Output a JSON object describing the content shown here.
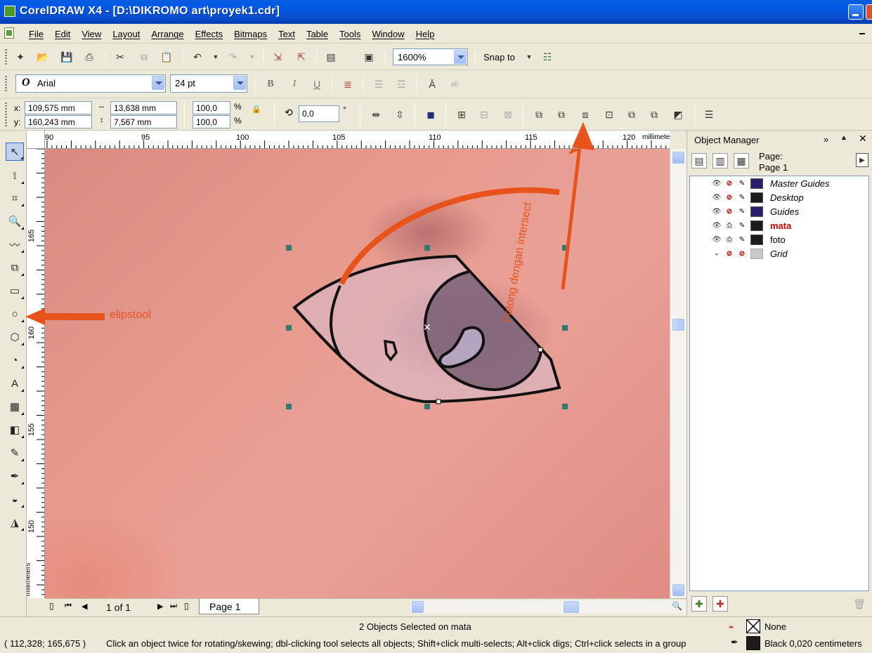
{
  "window": {
    "title": "CorelDRAW X4 - [D:\\DIKROMO art\\proyek1.cdr]"
  },
  "menu": [
    "File",
    "Edit",
    "View",
    "Layout",
    "Arrange",
    "Effects",
    "Bitmaps",
    "Text",
    "Table",
    "Tools",
    "Window",
    "Help"
  ],
  "standard_toolbar": {
    "zoom_level": "1600%",
    "snap_label": "Snap to"
  },
  "text_toolbar": {
    "font_name": "Arial",
    "font_size": "24 pt",
    "bold": "B",
    "italic": "I",
    "underline": "U"
  },
  "property_bar": {
    "x_label": "x:",
    "x_value": "109,575 mm",
    "y_label": "y:",
    "y_value": "160,243 mm",
    "width_value": "13,638 mm",
    "height_value": "7,567 mm",
    "scale_x": "100,0",
    "scale_y": "100,0",
    "percent": "%",
    "rotation": "0,0",
    "degree": "°"
  },
  "rulers": {
    "h_ticks": [
      "90",
      "95",
      "100",
      "105",
      "110",
      "115",
      "120"
    ],
    "h_unit": "millimeters",
    "v_ticks": [
      "165",
      "160",
      "155",
      "150"
    ],
    "v_unit": "millimeters"
  },
  "annotations": {
    "ellipse_tool": "elipstool",
    "intersect": "Potong dengan intersect"
  },
  "page_nav": {
    "count": "1 of 1",
    "page_tab": "Page 1"
  },
  "object_manager": {
    "title": "Object Manager",
    "page_label": "Page:",
    "page_name": "Page 1",
    "layers": [
      {
        "name": "Master Guides",
        "color": "#2a1f6e"
      },
      {
        "name": "Desktop",
        "color": "#1c1c1c"
      },
      {
        "name": "Guides",
        "color": "#2a1f6e"
      },
      {
        "name": "mata",
        "color": "#1c1c1c"
      },
      {
        "name": "foto",
        "color": "#1c1c1c"
      },
      {
        "name": "Grid",
        "color": "#c8c8c8"
      }
    ]
  },
  "status": {
    "selection": "2 Objects Selected on mata",
    "coords": "( 112,328; 165,675 )",
    "hint": "Click an object twice for rotating/skewing; dbl-clicking tool selects all objects; Shift+click multi-selects; Alt+click digs; Ctrl+click selects in a group",
    "fill": "None",
    "outline": "Black 0,020 centimeters"
  },
  "colors": {
    "annotation": "#e8531c",
    "titlebar": "#0a4fd1",
    "active_layer": "#cc0000"
  }
}
